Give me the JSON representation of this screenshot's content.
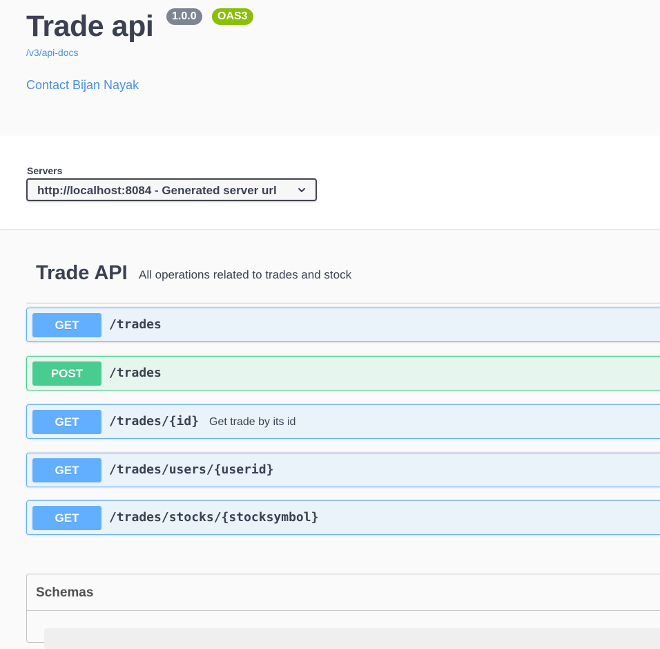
{
  "info": {
    "title": "Trade api",
    "version_badge": "1.0.0",
    "oas_badge": "OAS3",
    "api_docs_link": "/v3/api-docs",
    "contact_link": "Contact Bijan Nayak"
  },
  "servers": {
    "label": "Servers",
    "selected": "http://localhost:8084 - Generated server url"
  },
  "tag": {
    "name": "Trade API",
    "description": "All operations related to trades and stock"
  },
  "operations": [
    {
      "method": "GET",
      "path": "/trades",
      "summary": ""
    },
    {
      "method": "POST",
      "path": "/trades",
      "summary": ""
    },
    {
      "method": "GET",
      "path": "/trades/{id}",
      "summary": "Get trade by its id"
    },
    {
      "method": "GET",
      "path": "/trades/users/{userid}",
      "summary": ""
    },
    {
      "method": "GET",
      "path": "/trades/stocks/{stocksymbol}",
      "summary": ""
    }
  ],
  "schemas": {
    "title": "Schemas"
  },
  "colors": {
    "get": "#61affe",
    "post": "#49cc90",
    "link": "#4990e2",
    "version_badge": "#7d8492",
    "oas_badge": "#89bf04"
  },
  "icons": {
    "server_select": "chevron-down-icon"
  }
}
